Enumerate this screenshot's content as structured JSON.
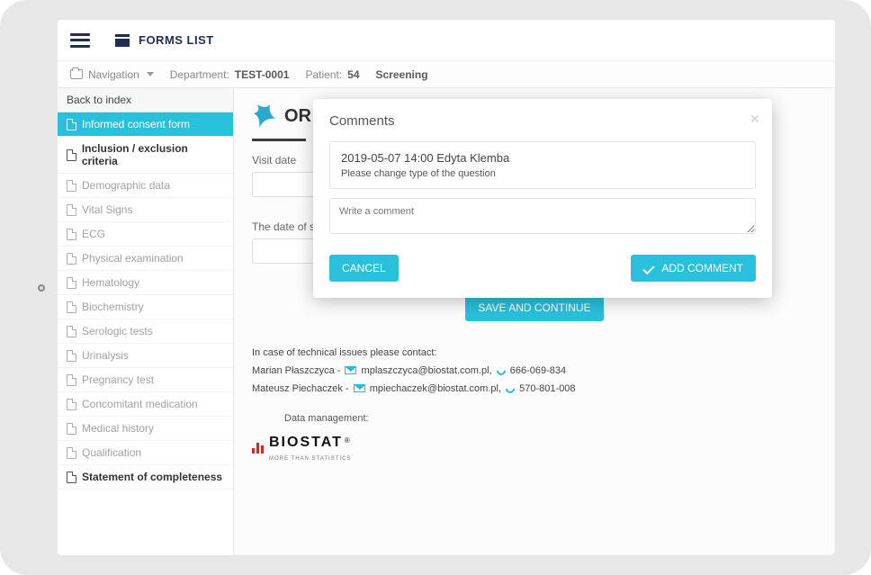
{
  "header": {
    "title": "FORMS LIST"
  },
  "breadcrumb": {
    "nav_label": "Navigation",
    "dept_label": "Department:",
    "dept_value": "TEST-0001",
    "patient_label": "Patient:",
    "patient_value": "54",
    "stage": "Screening"
  },
  "sidebar": {
    "back_label": "Back to index",
    "items": [
      {
        "label": "Informed consent form",
        "state": "active"
      },
      {
        "label": "Inclusion / exclusion criteria",
        "state": "bold"
      },
      {
        "label": "Demographic data",
        "state": ""
      },
      {
        "label": "Vital Signs",
        "state": ""
      },
      {
        "label": "ECG",
        "state": ""
      },
      {
        "label": "Physical examination",
        "state": ""
      },
      {
        "label": "Hematology",
        "state": ""
      },
      {
        "label": "Biochemistry",
        "state": ""
      },
      {
        "label": "Serologic tests",
        "state": ""
      },
      {
        "label": "Urinalysis",
        "state": ""
      },
      {
        "label": "Pregnancy test",
        "state": ""
      },
      {
        "label": "Concomitant medication",
        "state": ""
      },
      {
        "label": "Medical history",
        "state": ""
      },
      {
        "label": "Qualification",
        "state": ""
      },
      {
        "label": "Statement of completeness",
        "state": "bold"
      }
    ]
  },
  "main": {
    "logo_text": "OR",
    "field1_label": "Visit date",
    "field2_label": "The date of sig",
    "save_label": "SAVE AND CONTINUE"
  },
  "footer": {
    "intro": "In case of technical issues please contact:",
    "c1_name": "Marian Płaszczyca -",
    "c1_mail": "mplaszczyca@biostat.com.pl,",
    "c1_phone": "666-069-834",
    "c2_name": "Mateusz Piechaczek -",
    "c2_mail": "mpiechaczek@biostat.com.pl,",
    "c2_phone": "570-801-008",
    "dm_label": "Data management:",
    "brand": "BIOSTAT",
    "brand_sub": "MORE THAN STATISTICS",
    "reg": "®"
  },
  "modal": {
    "title": "Comments",
    "comment_meta": "2019-05-07 14:00 Edyta Klemba",
    "comment_body": "Please change type of the question",
    "placeholder": "Write a comment",
    "cancel": "CANCEL",
    "add": "ADD COMMENT"
  }
}
